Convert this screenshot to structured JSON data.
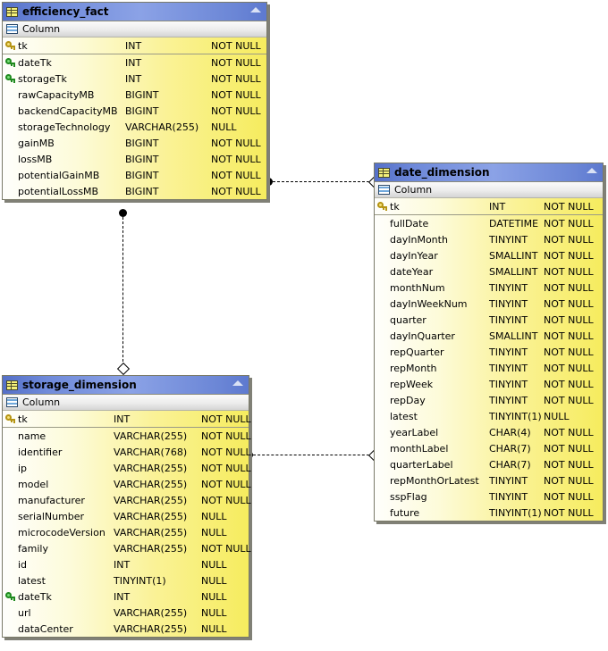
{
  "diagram": {
    "type": "entity-relationship-diagram",
    "column_header_label": "Column",
    "icons": {
      "table": "table-icon",
      "columns": "columns-icon",
      "collapse": "collapse-triangle-icon",
      "primary_key": "gold-key-icon",
      "foreign_key": "green-key-icon"
    },
    "colors": {
      "title_bar": "#6f8ada",
      "row_gradient_start": "#fefefc",
      "row_gradient_end": "#f6ec5e",
      "header_band": "#ececec",
      "border": "#7a7a68",
      "shadow": "#808076",
      "connector": "#000000"
    }
  },
  "tables": [
    {
      "name": "efficiency_fact",
      "columns": [
        {
          "key": "pk",
          "name": "tk",
          "type": "INT",
          "nullable": "NOT NULL"
        },
        {
          "key": "fk",
          "name": "dateTk",
          "type": "INT",
          "nullable": "NOT NULL"
        },
        {
          "key": "fk",
          "name": "storageTk",
          "type": "INT",
          "nullable": "NOT NULL"
        },
        {
          "key": "none",
          "name": "rawCapacityMB",
          "type": "BIGINT",
          "nullable": "NOT NULL"
        },
        {
          "key": "none",
          "name": "backendCapacityMB",
          "type": "BIGINT",
          "nullable": "NOT NULL"
        },
        {
          "key": "none",
          "name": "storageTechnology",
          "type": "VARCHAR(255)",
          "nullable": "NULL"
        },
        {
          "key": "none",
          "name": "gainMB",
          "type": "BIGINT",
          "nullable": "NOT NULL"
        },
        {
          "key": "none",
          "name": "lossMB",
          "type": "BIGINT",
          "nullable": "NOT NULL"
        },
        {
          "key": "none",
          "name": "potentialGainMB",
          "type": "BIGINT",
          "nullable": "NOT NULL"
        },
        {
          "key": "none",
          "name": "potentialLossMB",
          "type": "BIGINT",
          "nullable": "NOT NULL"
        }
      ]
    },
    {
      "name": "date_dimension",
      "columns": [
        {
          "key": "pk",
          "name": "tk",
          "type": "INT",
          "nullable": "NOT NULL"
        },
        {
          "key": "none",
          "name": "fullDate",
          "type": "DATETIME",
          "nullable": "NOT NULL"
        },
        {
          "key": "none",
          "name": "dayInMonth",
          "type": "TINYINT",
          "nullable": "NOT NULL"
        },
        {
          "key": "none",
          "name": "dayInYear",
          "type": "SMALLINT",
          "nullable": "NOT NULL"
        },
        {
          "key": "none",
          "name": "dateYear",
          "type": "SMALLINT",
          "nullable": "NOT NULL"
        },
        {
          "key": "none",
          "name": "monthNum",
          "type": "TINYINT",
          "nullable": "NOT NULL"
        },
        {
          "key": "none",
          "name": "dayInWeekNum",
          "type": "TINYINT",
          "nullable": "NOT NULL"
        },
        {
          "key": "none",
          "name": "quarter",
          "type": "TINYINT",
          "nullable": "NOT NULL"
        },
        {
          "key": "none",
          "name": "dayInQuarter",
          "type": "SMALLINT",
          "nullable": "NOT NULL"
        },
        {
          "key": "none",
          "name": "repQuarter",
          "type": "TINYINT",
          "nullable": "NOT NULL"
        },
        {
          "key": "none",
          "name": "repMonth",
          "type": "TINYINT",
          "nullable": "NOT NULL"
        },
        {
          "key": "none",
          "name": "repWeek",
          "type": "TINYINT",
          "nullable": "NOT NULL"
        },
        {
          "key": "none",
          "name": "repDay",
          "type": "TINYINT",
          "nullable": "NOT NULL"
        },
        {
          "key": "none",
          "name": "latest",
          "type": "TINYINT(1)",
          "nullable": "NULL"
        },
        {
          "key": "none",
          "name": "yearLabel",
          "type": "CHAR(4)",
          "nullable": "NOT NULL"
        },
        {
          "key": "none",
          "name": "monthLabel",
          "type": "CHAR(7)",
          "nullable": "NOT NULL"
        },
        {
          "key": "none",
          "name": "quarterLabel",
          "type": "CHAR(7)",
          "nullable": "NOT NULL"
        },
        {
          "key": "none",
          "name": "repMonthOrLatest",
          "type": "TINYINT",
          "nullable": "NOT NULL"
        },
        {
          "key": "none",
          "name": "sspFlag",
          "type": "TINYINT",
          "nullable": "NOT NULL"
        },
        {
          "key": "none",
          "name": "future",
          "type": "TINYINT(1)",
          "nullable": "NOT NULL"
        }
      ]
    },
    {
      "name": "storage_dimension",
      "columns": [
        {
          "key": "pk",
          "name": "tk",
          "type": "INT",
          "nullable": "NOT NULL"
        },
        {
          "key": "none",
          "name": "name",
          "type": "VARCHAR(255)",
          "nullable": "NOT NULL"
        },
        {
          "key": "none",
          "name": "identifier",
          "type": "VARCHAR(768)",
          "nullable": "NOT NULL"
        },
        {
          "key": "none",
          "name": "ip",
          "type": "VARCHAR(255)",
          "nullable": "NOT NULL"
        },
        {
          "key": "none",
          "name": "model",
          "type": "VARCHAR(255)",
          "nullable": "NOT NULL"
        },
        {
          "key": "none",
          "name": "manufacturer",
          "type": "VARCHAR(255)",
          "nullable": "NOT NULL"
        },
        {
          "key": "none",
          "name": "serialNumber",
          "type": "VARCHAR(255)",
          "nullable": "NULL"
        },
        {
          "key": "none",
          "name": "microcodeVersion",
          "type": "VARCHAR(255)",
          "nullable": "NULL"
        },
        {
          "key": "none",
          "name": "family",
          "type": "VARCHAR(255)",
          "nullable": "NOT NULL"
        },
        {
          "key": "none",
          "name": "id",
          "type": "INT",
          "nullable": "NULL"
        },
        {
          "key": "none",
          "name": "latest",
          "type": "TINYINT(1)",
          "nullable": "NULL"
        },
        {
          "key": "fk",
          "name": "dateTk",
          "type": "INT",
          "nullable": "NULL"
        },
        {
          "key": "none",
          "name": "url",
          "type": "VARCHAR(255)",
          "nullable": "NULL"
        },
        {
          "key": "none",
          "name": "dataCenter",
          "type": "VARCHAR(255)",
          "nullable": "NULL"
        }
      ]
    }
  ],
  "relationships": [
    {
      "from": "efficiency_fact",
      "to": "date_dimension",
      "from_marker": "filled-circle",
      "to_marker": "open-diamond"
    },
    {
      "from": "efficiency_fact",
      "to": "storage_dimension",
      "from_marker": "filled-circle",
      "to_marker": "open-diamond"
    },
    {
      "from": "storage_dimension",
      "to": "date_dimension",
      "from_marker": "filled-circle",
      "to_marker": "open-diamond"
    }
  ]
}
